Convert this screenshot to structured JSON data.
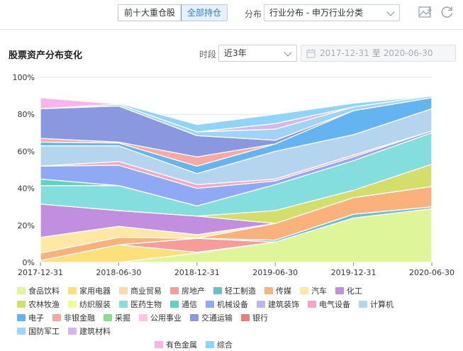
{
  "toolbar": {
    "seg_top10": "前十大重仓股",
    "seg_all": "全部持仓",
    "dist_label": "分布",
    "dist_select_value": "行业分布 - 申万行业分类",
    "icons": [
      "image-download-icon",
      "refresh-icon"
    ]
  },
  "section": {
    "title": "股票资产分布变化",
    "period_label": "时段",
    "period_value": "近3年",
    "date_start": "2017-12-31",
    "date_sep": "至",
    "date_end": "2020-06-30"
  },
  "chart_data": {
    "type": "area",
    "stacked": true,
    "x": [
      "2017-12-31",
      "2018-06-30",
      "2018-12-31",
      "2019-06-30",
      "2019-12-31",
      "2020-06-30"
    ],
    "ylim": [
      0,
      100
    ],
    "y_ticks": [
      "0%",
      "20%",
      "40%",
      "60%",
      "80%",
      "100%"
    ],
    "grid": true,
    "legend_position": "bottom",
    "series": [
      {
        "name": "食品饮料",
        "color": "#dff59a",
        "values": [
          0,
          0,
          5,
          11,
          24,
          29
        ]
      },
      {
        "name": "家用电器",
        "color": "#fde07a",
        "values": [
          1,
          9.5,
          0.5,
          0,
          0,
          0
        ]
      },
      {
        "name": "商业贸易",
        "color": "#fbd9a9",
        "values": [
          0,
          0,
          0,
          0,
          0,
          0
        ]
      },
      {
        "name": "房地产",
        "color": "#f79b9b",
        "values": [
          0,
          0,
          7.5,
          0,
          0,
          0
        ]
      },
      {
        "name": "轻工制造",
        "color": "#69c0c9",
        "values": [
          0,
          0,
          0,
          1,
          2,
          1
        ]
      },
      {
        "name": "传媒",
        "color": "#fbb17b",
        "values": [
          4,
          4,
          0,
          9,
          9,
          11
        ]
      },
      {
        "name": "汽车",
        "color": "#ffe7a6",
        "values": [
          8.5,
          6,
          2,
          0,
          0,
          0
        ]
      },
      {
        "name": "化工",
        "color": "#c28ee0",
        "values": [
          18,
          8.5,
          10,
          0,
          0,
          0
        ]
      },
      {
        "name": "农林牧渔",
        "color": "#d3de6b",
        "values": [
          0,
          0,
          0,
          7,
          4,
          12
        ]
      },
      {
        "name": "纺织服装",
        "color": "#f4f79a",
        "values": [
          0,
          0,
          0,
          0,
          0,
          0
        ]
      },
      {
        "name": "医药生物",
        "color": "#85dede",
        "values": [
          10,
          13.5,
          5.5,
          14,
          16,
          17
        ]
      },
      {
        "name": "通信",
        "color": "#5fd3c2",
        "values": [
          3.5,
          0,
          0,
          0,
          0,
          0
        ]
      },
      {
        "name": "机械设备",
        "color": "#8fa9f5",
        "values": [
          7,
          11,
          9.5,
          2,
          2,
          1
        ]
      },
      {
        "name": "建筑装饰",
        "color": "#b9b6f3",
        "values": [
          0,
          0,
          0,
          0,
          0,
          0
        ]
      },
      {
        "name": "电气设备",
        "color": "#f3a6c8",
        "values": [
          0,
          2,
          2,
          1,
          1,
          0
        ]
      },
      {
        "name": "计算机",
        "color": "#b5d5ef",
        "values": [
          11,
          8.5,
          6,
          15,
          11,
          12
        ]
      },
      {
        "name": "电子",
        "color": "#63b4f0",
        "values": [
          2,
          1.5,
          4,
          4,
          13,
          6
        ]
      },
      {
        "name": "非银金融",
        "color": "#f9a9a3",
        "values": [
          2,
          0.5,
          5,
          0,
          0,
          0
        ]
      },
      {
        "name": "采掘",
        "color": "#88dd8d",
        "values": [
          0,
          0,
          0,
          0,
          0,
          0
        ]
      },
      {
        "name": "公用事业",
        "color": "#fac6e3",
        "values": [
          0,
          0,
          0,
          0,
          0,
          0
        ]
      },
      {
        "name": "交通运输",
        "color": "#8a98df",
        "values": [
          16,
          19.5,
          11.5,
          2,
          0,
          0
        ]
      },
      {
        "name": "银行",
        "color": "#ee7a7a",
        "values": [
          0,
          0,
          0,
          0,
          0,
          0
        ]
      },
      {
        "name": "国防军工",
        "color": "#9fd4f7",
        "values": [
          0,
          1,
          2,
          6,
          2,
          1
        ]
      },
      {
        "name": "建筑材料",
        "color": "#d7b6f0",
        "values": [
          0,
          0,
          0,
          3,
          0,
          0
        ]
      },
      {
        "name": "有色金属",
        "color": "#fbb3ec",
        "values": [
          6,
          0,
          0,
          0,
          0,
          0
        ]
      },
      {
        "name": "综合",
        "color": "#8fd4fb",
        "values": [
          0,
          0.5,
          4,
          5,
          2,
          0
        ]
      }
    ]
  }
}
